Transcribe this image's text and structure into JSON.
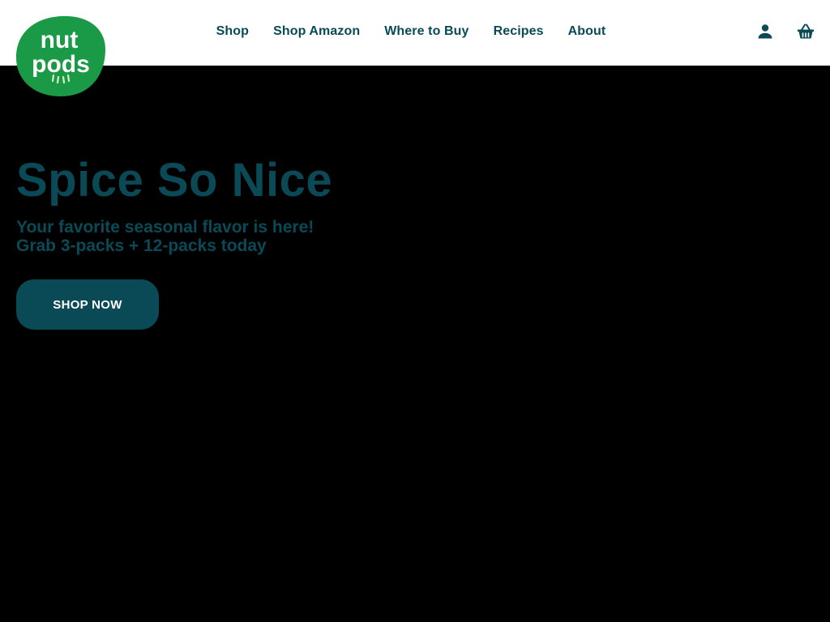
{
  "brand": {
    "logo_text_top": "nut",
    "logo_text_bottom": "pods",
    "color_green": "#1a9a46",
    "color_teal": "#0a4a57"
  },
  "nav": {
    "items": [
      {
        "label": "Shop"
      },
      {
        "label": "Shop Amazon"
      },
      {
        "label": "Where to Buy"
      },
      {
        "label": "Recipes"
      },
      {
        "label": "About"
      }
    ]
  },
  "header_icons": {
    "account": "user-icon",
    "cart": "basket-icon"
  },
  "hero": {
    "title": "Spice So Nice",
    "subtitle_line1": "Your favorite seasonal flavor is here!",
    "subtitle_line2": "Grab 3-packs + 12-packs today",
    "cta_label": "SHOP NOW"
  }
}
